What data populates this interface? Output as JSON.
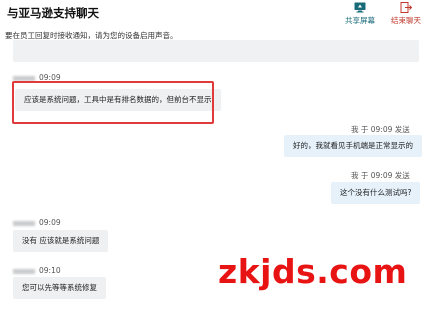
{
  "header": {
    "title": "与亚马逊支持聊天",
    "share_screen_label": "共享屏幕",
    "end_chat_label": "结束聊天"
  },
  "notice": {
    "text": "要在员工回复时接收通知，请为您的设备启用声音。",
    "box_line1": "",
    "box_line2": ""
  },
  "messages": [
    {
      "side": "in",
      "sender": "",
      "time": "09:09",
      "text": "应该是系统问题，工具中是有排名数据的，但前台不显示"
    },
    {
      "side": "out",
      "sender": "我",
      "time": "于 09:09",
      "status": "发送",
      "text": "好的，我就看见手机端是正常显示的"
    },
    {
      "side": "out",
      "sender": "我",
      "time": "于 09:09",
      "status": "发送",
      "text": "这个没有什么测试吗?"
    },
    {
      "side": "in",
      "sender": "",
      "time": "09:09",
      "text": "没有 应该就是系统问题"
    },
    {
      "side": "in",
      "sender": "",
      "time": "09:10",
      "text": "您可以先等等系统修复"
    }
  ],
  "watermark": "zkjds.com",
  "colors": {
    "share": "#1a6b7a",
    "end": "#c0392b",
    "highlight": "#e03a3a",
    "watermark": "#e81414"
  }
}
